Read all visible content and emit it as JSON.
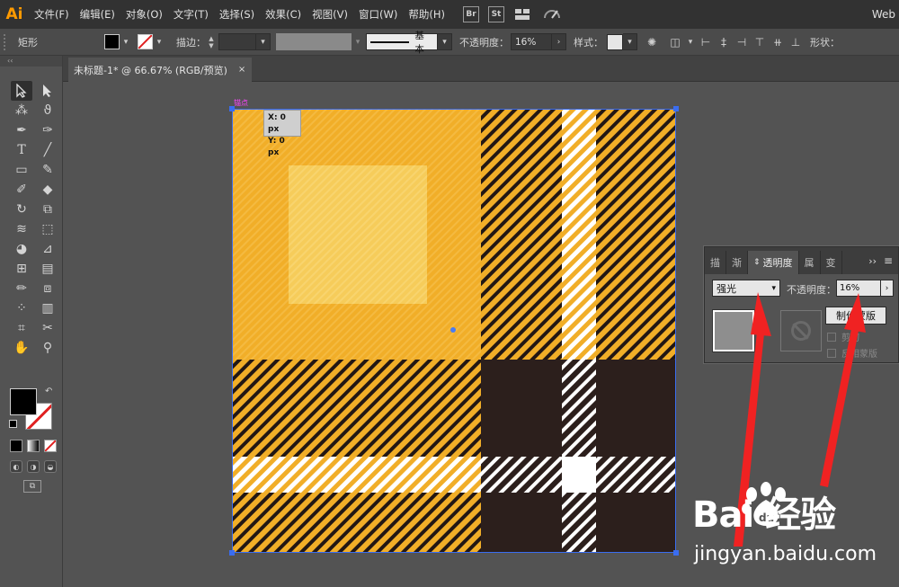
{
  "app": {
    "logo": "Ai",
    "workspace": "Web"
  },
  "menu": {
    "items": [
      "文件(F)",
      "编辑(E)",
      "对象(O)",
      "文字(T)",
      "选择(S)",
      "效果(C)",
      "视图(V)",
      "窗口(W)",
      "帮助(H)"
    ],
    "bridge_badge": "Br",
    "stock_badge": "St"
  },
  "control_bar": {
    "object_type": "矩形",
    "stroke_label": "描边：",
    "stroke_style": "基本",
    "opacity_label": "不透明度：",
    "opacity_value": "16%",
    "style_label": "样式：",
    "shape_label": "形状："
  },
  "document": {
    "tab_title": "未标题-1* @ 66.67% (RGB/预览)",
    "close": "×"
  },
  "canvas": {
    "anchor_label": "锚点",
    "coord_x": "X: 0 px",
    "coord_y": "Y: 0 px",
    "colors": {
      "yellow_dark": "#f1ae28",
      "yellow_light": "#f6cc5a",
      "brown": "#2c1f1c",
      "white": "#ffffff"
    }
  },
  "transparency_panel": {
    "tabs": [
      "描",
      "渐",
      "透明度",
      "属",
      "变"
    ],
    "more": "››",
    "blend_mode": "强光",
    "opacity_label": "不透明度：",
    "opacity_value": "16%",
    "make_mask_button": "制作蒙版",
    "clip_label": "剪切",
    "invert_label": "反相蒙版"
  },
  "watermark": {
    "brand": "Bai  经验",
    "url": "jingyan.baidu.com"
  }
}
